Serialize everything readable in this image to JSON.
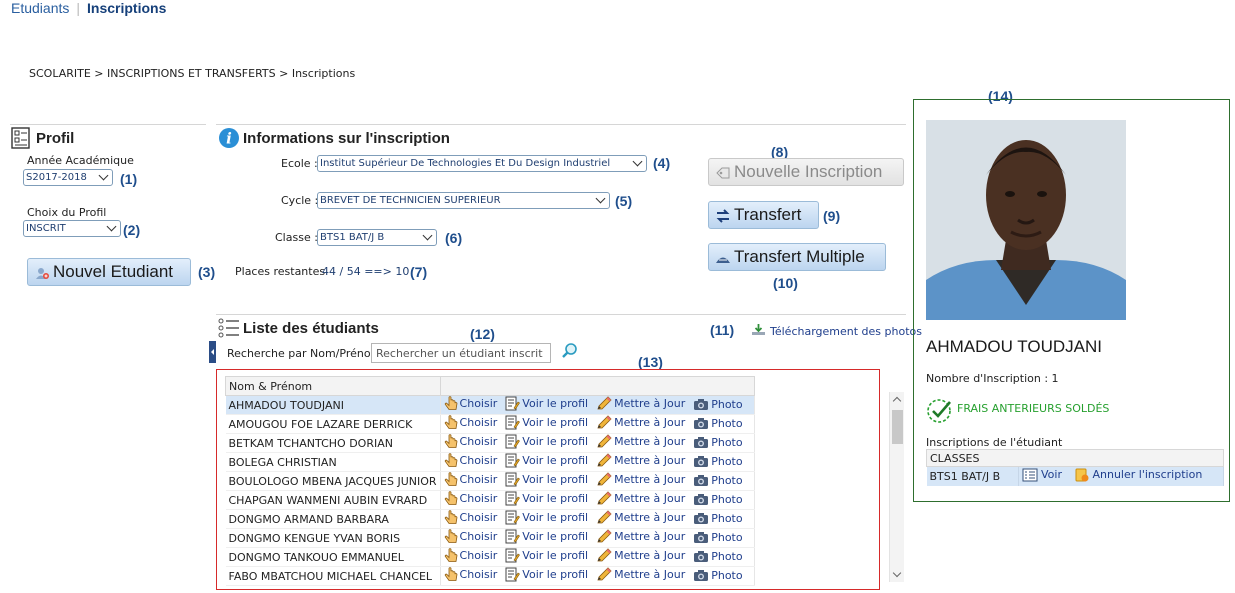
{
  "topnav": {
    "tab1": "Etudiants",
    "tab2": "Inscriptions"
  },
  "breadcrumb": "SCOLARITE > INSCRIPTIONS ET TRANSFERTS > Inscriptions",
  "profil": {
    "title": "Profil",
    "annee_label": "Année Académique",
    "annee_value": "S2017-2018",
    "choix_label": "Choix du Profil",
    "choix_value": "INSCRIT",
    "nouvel_etudiant": "Nouvel Etudiant"
  },
  "info": {
    "title": "Informations sur l'inscription",
    "ecole_label": "Ecole :",
    "ecole_value": "Institut Supérieur De Technologies Et Du Design Industriel",
    "cycle_label": "Cycle :",
    "cycle_value": "BREVET DE TECHNICIEN SUPÉRIEUR",
    "classe_label": "Classe :",
    "classe_value": "BTS1 BAT/J B",
    "places_label": "Places restantes",
    "places_value": "44 / 54 ==> 10"
  },
  "buttons": {
    "nouvelle_inscription": "Nouvelle Inscription",
    "transfert": "Transfert",
    "transfert_multiple": "Transfert Multiple"
  },
  "markers": [
    "(1)",
    "(2)",
    "(3)",
    "(4)",
    "(5)",
    "(6)",
    "(7)",
    "(8)",
    "(9)",
    "(10)",
    "(11)",
    "(12)",
    "(13)",
    "(14)"
  ],
  "liste": {
    "title": "Liste des étudiants",
    "search_label": "Recherche par Nom/Prénom",
    "search_placeholder": "Rechercher un étudiant inscrit",
    "download": "Téléchargement des photos",
    "col_name": "Nom & Prénom",
    "actions": [
      "Choisir",
      "Voir le profil",
      "Mettre à Jour",
      "Photo"
    ],
    "rows": [
      "AHMADOU TOUDJANI",
      "AMOUGOU FOE LAZARE DERRICK",
      "BETKAM TCHANTCHO DORIAN",
      "BOLEGA CHRISTIAN",
      "BOULOLOGO MBENA JACQUES JUNIOR",
      "CHAPGAN WANMENI AUBIN EVRARD",
      "DONGMO ARMAND BARBARA",
      "DONGMO KENGUE YVAN BORIS",
      "DONGMO TANKOUO EMMANUEL",
      "FABO MBATCHOU MICHAEL CHANCEL"
    ]
  },
  "student": {
    "name": "AHMADOU TOUDJANI",
    "nb_label": "Nombre d'Inscription :",
    "nb_value": "1",
    "frais": "FRAIS ANTERIEURS SOLDÉS",
    "insc_label": "Inscriptions de l'étudiant",
    "col_classes": "CLASSES",
    "classe": "BTS1 BAT/J B",
    "voir": "Voir",
    "annuler": "Annuler l'inscription"
  },
  "colors": {
    "accent": "#1f4e8c",
    "red_frame": "#d62a2a",
    "green_frame": "#2e6e2e",
    "ok_green": "#27a02f",
    "selected_row": "#d6e6f7"
  }
}
